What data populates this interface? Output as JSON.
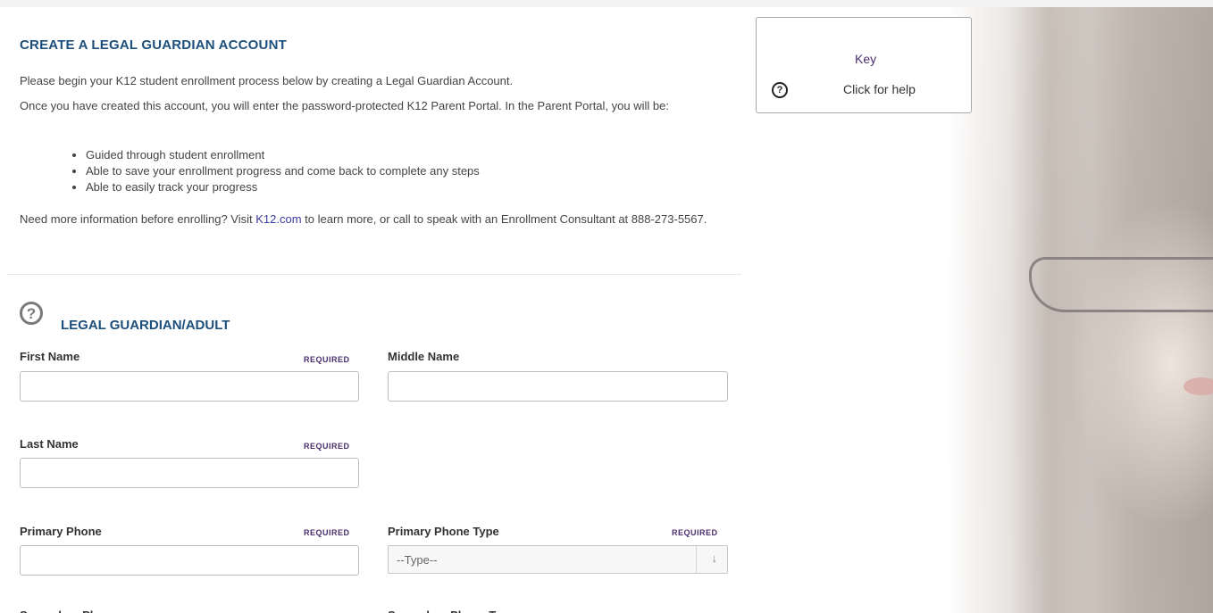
{
  "intro": {
    "title": "CREATE A LEGAL GUARDIAN ACCOUNT",
    "p1": "Please begin your K12 student enrollment process below by creating a Legal Guardian Account.",
    "p2": "Once you have created this account, you will enter the password-protected K12 Parent Portal. In the Parent Portal, you will be:",
    "bullets": [
      "Guided through student enrollment",
      "Able to save your enrollment progress and come back to complete any steps",
      "Able to easily track your progress"
    ],
    "p3_before": "Need more information before enrolling? Visit ",
    "p3_link": "K12.com",
    "p3_after": " to learn more, or call to speak with an Enrollment Consultant at 888-273-5567."
  },
  "key": {
    "title": "Key",
    "help_label": "Click for help",
    "help_glyph": "?"
  },
  "section": {
    "title": "LEGAL GUARDIAN/ADULT",
    "help_glyph": "?"
  },
  "form": {
    "required_label": "REQUIRED",
    "first_name_label": "First Name",
    "first_name_value": "",
    "middle_name_label": "Middle Name",
    "middle_name_value": "",
    "last_name_label": "Last Name",
    "last_name_value": "",
    "primary_phone_label": "Primary Phone",
    "primary_phone_value": "",
    "primary_phone_type_label": "Primary Phone Type",
    "primary_phone_type_value": "--Type--",
    "secondary_phone_label": "Secondary Phone",
    "secondary_phone_type_label": "Secondary Phone Type",
    "select_arrow": "↓"
  },
  "colors": {
    "heading": "#1d4f7c",
    "required": "#4a2f6e",
    "link": "#3a3a9e"
  }
}
